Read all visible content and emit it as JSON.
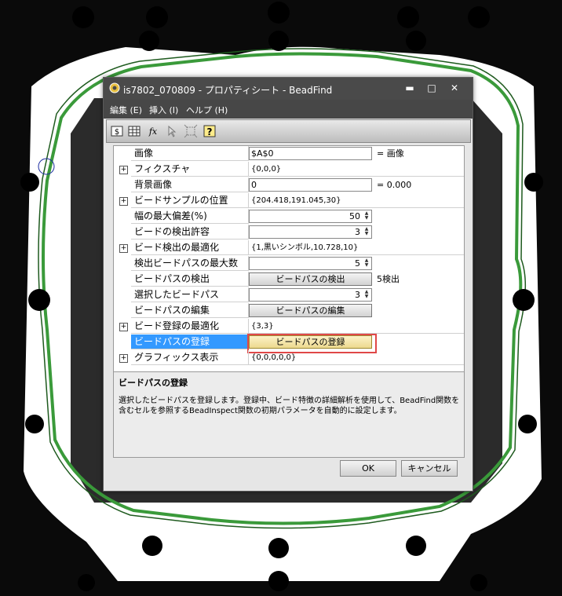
{
  "window": {
    "title": "is7802_070809 - プロパティシート - BeadFind",
    "minimize_glyph": "▬",
    "maximize_glyph": "□",
    "close_glyph": "✕"
  },
  "menu": [
    "編集 (E)",
    "挿入 (I)",
    "ヘルプ (H)"
  ],
  "toolbar": {
    "icons": [
      "dollar-cell-icon",
      "table-icon",
      "function-icon",
      "pointer-icon",
      "crosshair-icon",
      "help-icon"
    ],
    "fx_glyph": "fx",
    "help_glyph": "?"
  },
  "grid": {
    "expander_glyph": "+",
    "rows": {
      "image": {
        "label": "画像",
        "value": "$A$0",
        "side": "= 画像"
      },
      "fixture": {
        "label": "フィクスチャ",
        "value": "{0,0,0}"
      },
      "background": {
        "label": "背景画像",
        "value": "0",
        "side": "= 0.000"
      },
      "sample_pos": {
        "label": "ビードサンプルの位置",
        "value": "{204.418,191.045,30}"
      },
      "max_width_dev": {
        "label": "幅の最大偏差(%)",
        "value": "50"
      },
      "detect_tol": {
        "label": "ビードの検出許容",
        "value": "3"
      },
      "detect_opt": {
        "label": "ビード検出の最適化",
        "value": "{1,黒いシンボル,10.728,10}"
      },
      "max_paths": {
        "label": "検出ビードパスの最大数",
        "value": "5"
      },
      "path_detect": {
        "label": "ビードパスの検出",
        "button": "ビードパスの検出",
        "side": "5検出"
      },
      "selected_path": {
        "label": "選択したビードパス",
        "value": "3"
      },
      "path_edit": {
        "label": "ビードパスの編集",
        "button": "ビードパスの編集"
      },
      "register_opt": {
        "label": "ビード登録の最適化",
        "value": "{3,3}"
      },
      "path_register": {
        "label": "ビードパスの登録",
        "button": "ビードパスの登録"
      },
      "graphics": {
        "label": "グラフィックス表示",
        "value": "{0,0,0,0,0}"
      }
    }
  },
  "description": {
    "title": "ビードパスの登録",
    "text": "選択したビードパスを登録します。登録中、ビード特徴の詳細解析を使用して、BeadFind関数を含むセルを参照するBeadInspect関数の初期パラメータを自動的に設定します。"
  },
  "footer": {
    "ok": "OK",
    "cancel": "キャンセル"
  },
  "colors": {
    "selection": "#3399ff",
    "highlight_frame": "#e04848",
    "bead_path": "#3a9a3a",
    "title_bar": "#4a4a4a"
  }
}
